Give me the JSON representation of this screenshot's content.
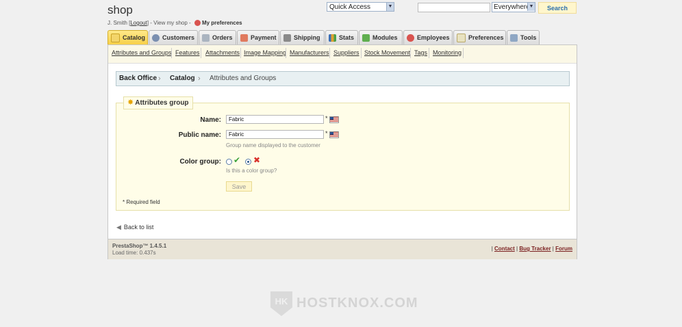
{
  "header": {
    "shop_title": "shop",
    "user_name": "J. Smith",
    "logout": "Logout",
    "view_shop": "View my shop",
    "preferences": "My preferences"
  },
  "quick_access": {
    "label": "Quick Access"
  },
  "search": {
    "placeholder": "",
    "scope": "Everywhere",
    "button": "Search"
  },
  "tabs": [
    {
      "label": "Catalog",
      "active": true,
      "icon": "folder-icon"
    },
    {
      "label": "Customers",
      "icon": "customer-icon"
    },
    {
      "label": "Orders",
      "icon": "cart-icon"
    },
    {
      "label": "Payment",
      "icon": "payment-icon"
    },
    {
      "label": "Shipping",
      "icon": "truck-icon"
    },
    {
      "label": "Stats",
      "icon": "chart-icon"
    },
    {
      "label": "Modules",
      "icon": "puzzle-icon"
    },
    {
      "label": "Employees",
      "icon": "employee-icon"
    },
    {
      "label": "Preferences",
      "icon": "preferences-icon"
    },
    {
      "label": "Tools",
      "icon": "wrench-icon"
    }
  ],
  "subnav": [
    "Attributes and Groups",
    "Features",
    "Attachments",
    "Image Mapping",
    "Manufacturers",
    "Suppliers",
    "Stock Movement",
    "Tags",
    "Monitoring"
  ],
  "breadcrumb": [
    "Back Office",
    "Catalog",
    "Attributes and Groups"
  ],
  "form": {
    "legend": "Attributes group",
    "name_label": "Name:",
    "name_value": "Fabric",
    "public_name_label": "Public name:",
    "public_name_value": "Fabric",
    "public_name_hint": "Group name displayed to the customer",
    "color_group_label": "Color group:",
    "color_group_hint": "Is this a color group?",
    "color_group_selected": "no",
    "required_marker": "*",
    "save": "Save",
    "required_note": "* Required field"
  },
  "back_to_list": "Back to list",
  "footer": {
    "version": "PrestaShop™ 1.4.5.1",
    "load_time": "Load time: 0.437s",
    "links": [
      "Contact",
      "Bug Tracker",
      "Forum"
    ]
  },
  "watermark": {
    "text": "HOSTKNOX.COM",
    "mark": "HK"
  }
}
